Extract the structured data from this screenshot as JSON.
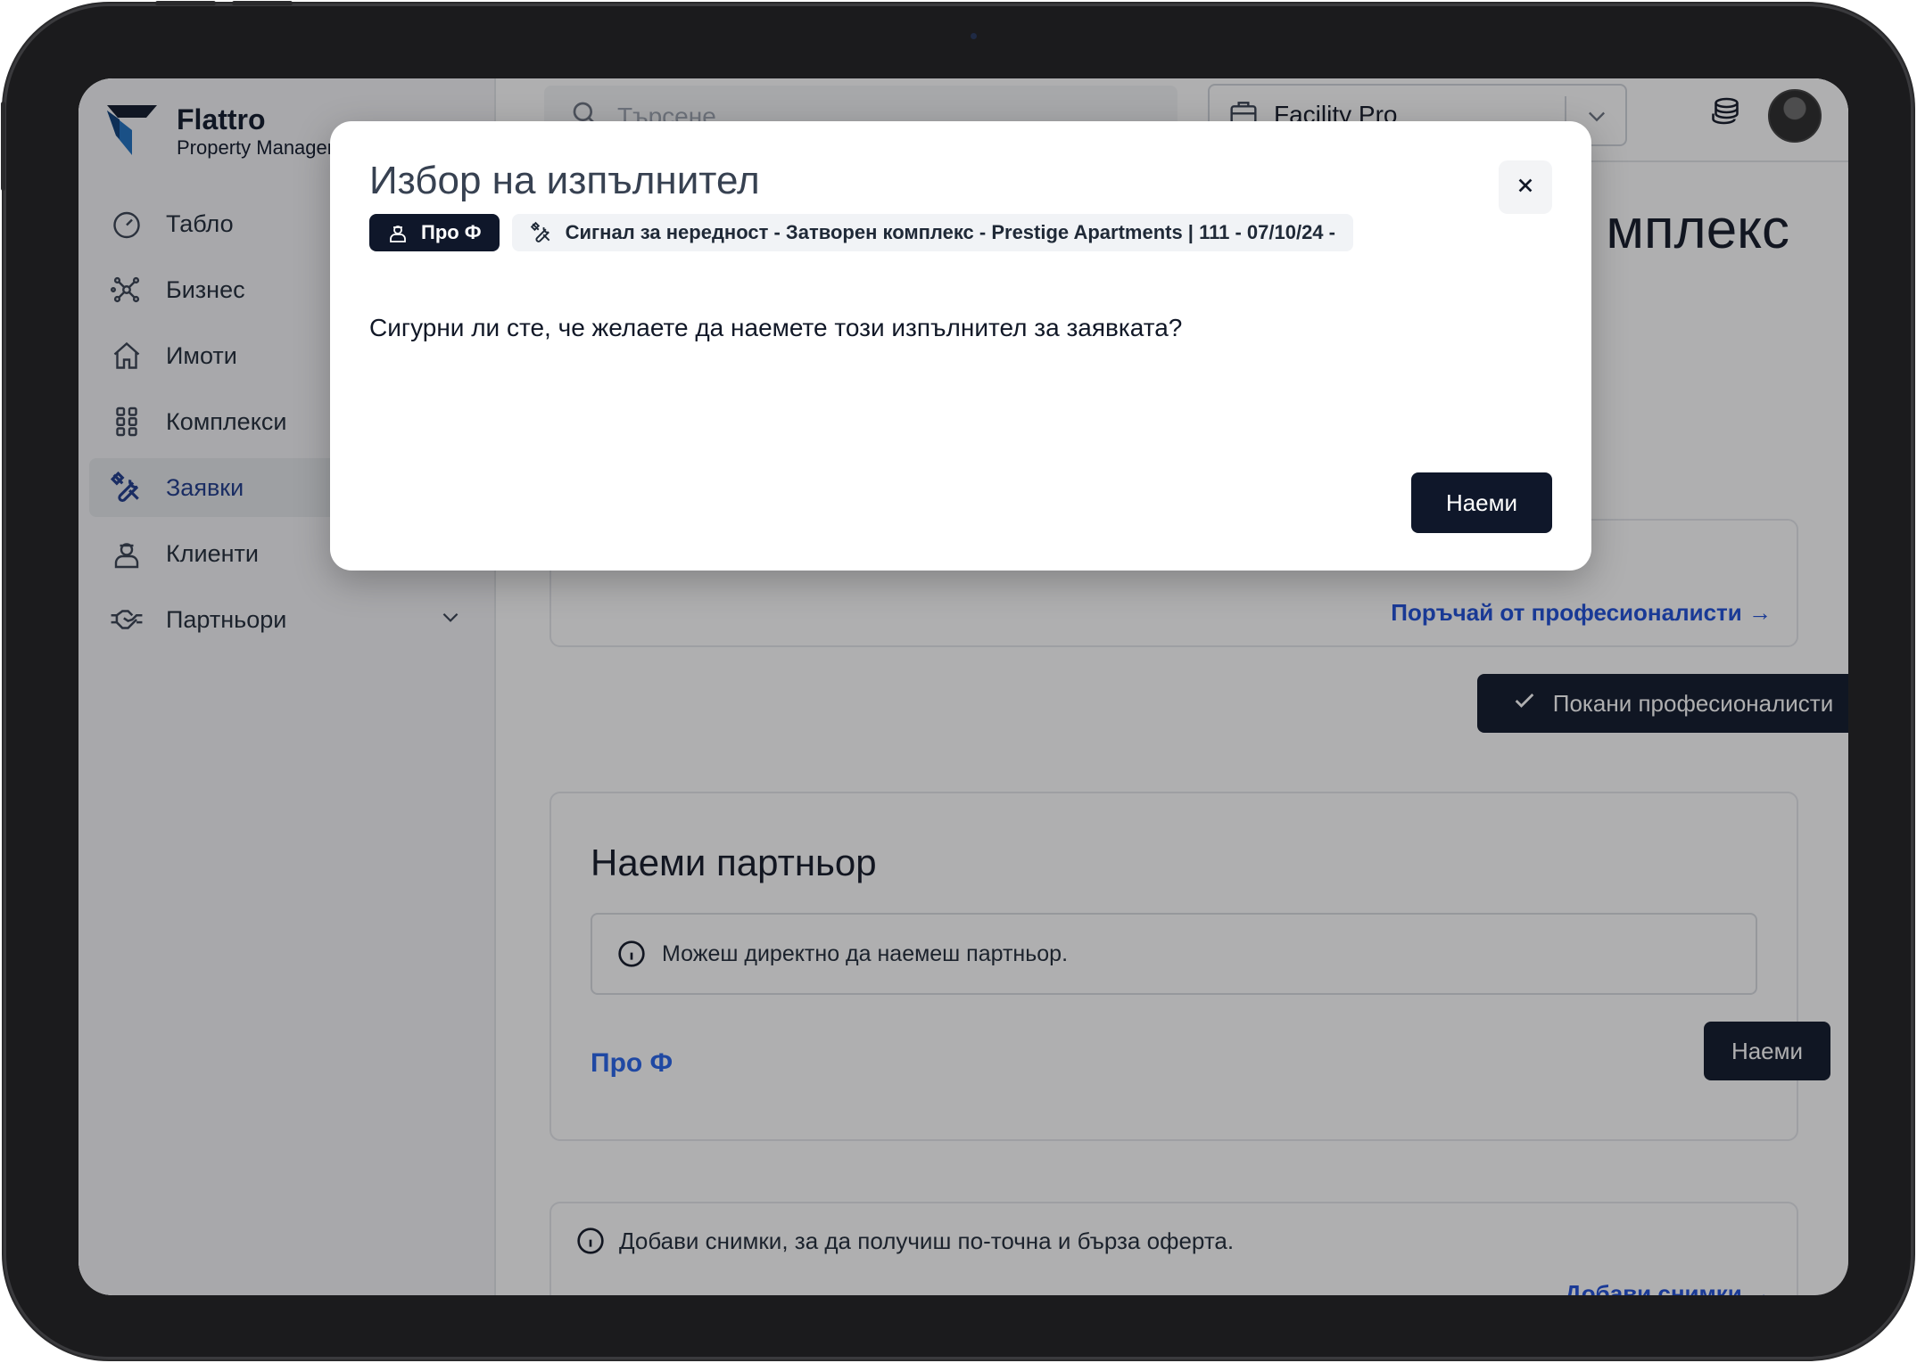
{
  "brand": {
    "name": "Flattro",
    "subtitle": "Property Management"
  },
  "sidebar": {
    "items": [
      {
        "label": "Табло",
        "icon": "dashboard-gauge-icon"
      },
      {
        "label": "Бизнес",
        "icon": "network-nodes-icon"
      },
      {
        "label": "Имоти",
        "icon": "home-icon"
      },
      {
        "label": "Комплекси",
        "icon": "grid-icon"
      },
      {
        "label": "Заявки",
        "icon": "tools-icon",
        "active": true
      },
      {
        "label": "Клиенти",
        "icon": "person-icon"
      },
      {
        "label": "Партньори",
        "icon": "handshake-icon",
        "expandable": true
      }
    ]
  },
  "topbar": {
    "search_placeholder": "Търсене",
    "company": "Facility Pro"
  },
  "page": {
    "title_tail": "мплекс",
    "card1_link": "Поръчай от професионалисти →",
    "invite_button": "Покани професионалисти",
    "hire_partner": {
      "heading": "Наеми партньор",
      "info": "Можеш директно да наемеш партньор.",
      "partner_name": "Про Ф",
      "hire_button": "Наеми"
    },
    "photos": {
      "info": "Добави снимки, за да получиш по-точна и бърза оферта.",
      "link": "Добави снимки →"
    }
  },
  "modal": {
    "title": "Избор на изпълнител",
    "chip_contractor": "Про Ф",
    "chip_request": "Сигнал за нередност - Затворен комплекс - Prestige Apartments | 111 - 07/10/24 -",
    "message": "Сигурни ли сте, че желаете да наемете този изпълнител за заявката?",
    "confirm_button": "Наеми"
  },
  "colors": {
    "primary_dark": "#0f172a",
    "link_blue": "#1d4ed8",
    "active_nav": "#1e3a8a"
  }
}
